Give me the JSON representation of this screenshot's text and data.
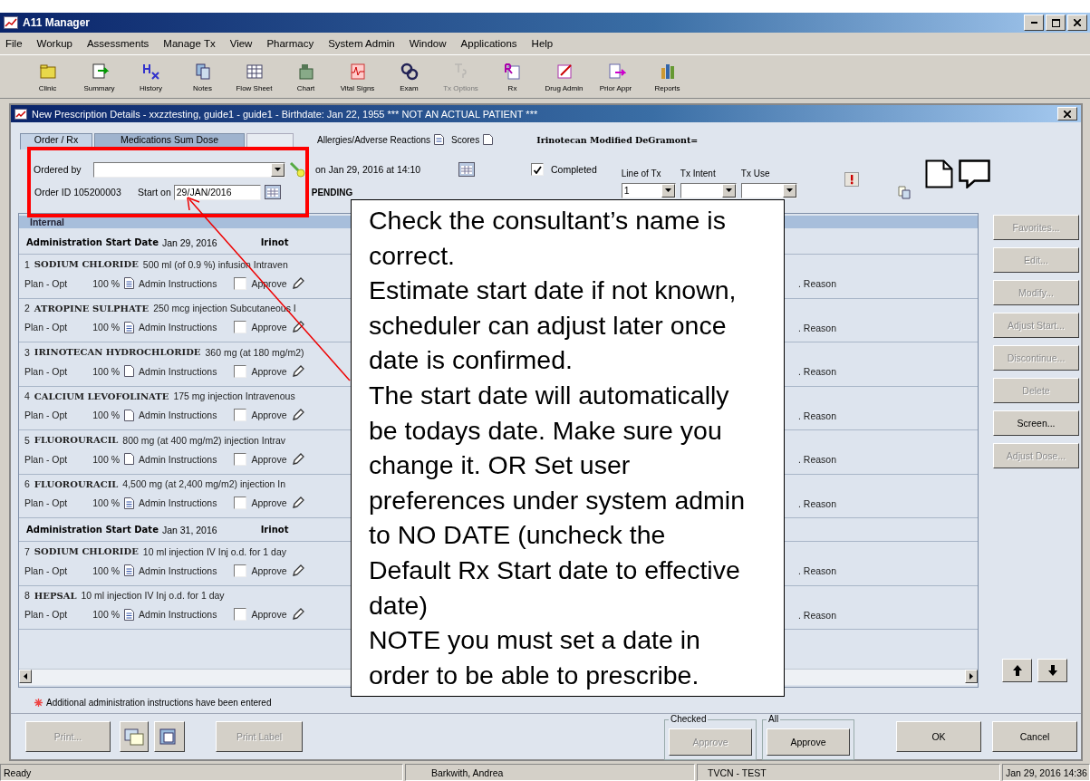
{
  "window": {
    "title": "A11 Manager"
  },
  "menu": [
    "File",
    "Workup",
    "Assessments",
    "Manage Tx",
    "View",
    "Pharmacy",
    "System Admin",
    "Window",
    "Applications",
    "Help"
  ],
  "toolbar": [
    {
      "label": "Clinic",
      "disabled": false
    },
    {
      "label": "Summary",
      "disabled": false
    },
    {
      "label": "History",
      "disabled": false
    },
    {
      "label": "Notes",
      "disabled": false
    },
    {
      "label": "Flow Sheet",
      "disabled": false
    },
    {
      "label": "Chart",
      "disabled": false
    },
    {
      "label": "Vital Signs",
      "disabled": false
    },
    {
      "label": "Exam",
      "disabled": false
    },
    {
      "label": "Tx Options",
      "disabled": true
    },
    {
      "label": "Rx",
      "disabled": false
    },
    {
      "label": "Drug Admin",
      "disabled": false
    },
    {
      "label": "Prior Appr",
      "disabled": false
    },
    {
      "label": "Reports",
      "disabled": false
    }
  ],
  "dialog": {
    "title": "New Prescription Details - xxzztesting, guide1  - guide1 - Birthdate: Jan 22, 1955 *** NOT AN ACTUAL PATIENT ***",
    "tabs": [
      {
        "label": "Order / Rx",
        "selected": true
      },
      {
        "label": "Medications Sum Dose",
        "selected": false
      }
    ],
    "allergies": "Allergies/Adverse Reactions",
    "scores": "Scores",
    "regimen": "Irinotecan Modified DeGramont=",
    "ordered_by_label": "Ordered by",
    "ordered_on": "on Jan 29, 2016  at 14:10",
    "completed": {
      "label": "Completed",
      "checked": true
    },
    "line_of_tx": {
      "label": "Line of Tx",
      "value": "1"
    },
    "tx_intent": {
      "label": "Tx Intent"
    },
    "tx_use": {
      "label": "Tx Use"
    },
    "order_id": "Order ID 105200003",
    "start_on": {
      "label": "Start on",
      "value": "29/JAN/2016"
    },
    "status": "PENDING",
    "section": "Internal",
    "groups": [
      {
        "label": "Administration Start Date",
        "date": "Jan 29, 2016",
        "regimen": "Irinot",
        "items": [
          {
            "number": "1",
            "drug": "SODIUM CHLORIDE",
            "detail": "500 ml (of 0.9 %) infusion Intraven",
            "plan": "Plan - Opt",
            "percent": "100 %",
            "has_instructions": true,
            "instructions": "Admin Instructions",
            "approved": false,
            "approve": "Approve",
            "reason": ". Reason"
          },
          {
            "number": "2",
            "drug": "ATROPINE SULPHATE",
            "detail": "250 mcg injection Subcutaneous I",
            "plan": "Plan - Opt",
            "percent": "100 %",
            "has_instructions": true,
            "instructions": "Admin Instructions",
            "approved": false,
            "approve": "Approve",
            "reason": ". Reason"
          },
          {
            "number": "3",
            "drug": "IRINOTECAN HYDROCHLORIDE",
            "detail": "360 mg (at 180 mg/m2)",
            "plan": "Plan - Opt",
            "percent": "100 %",
            "has_instructions": false,
            "instructions": "Admin Instructions",
            "approved": false,
            "approve": "Approve",
            "reason": ". Reason"
          },
          {
            "number": "4",
            "drug": "CALCIUM LEVOFOLINATE",
            "detail": "175 mg injection Intravenous",
            "plan": "Plan - Opt",
            "percent": "100 %",
            "has_instructions": false,
            "instructions": "Admin Instructions",
            "approved": false,
            "approve": "Approve",
            "reason": ". Reason"
          },
          {
            "number": "5",
            "drug": "FLUOROURACIL",
            "detail": "800 mg (at 400 mg/m2) injection Intrav",
            "plan": "Plan - Opt",
            "percent": "100 %",
            "has_instructions": false,
            "instructions": "Admin Instructions",
            "approved": false,
            "approve": "Approve",
            "reason": ". Reason"
          },
          {
            "number": "6",
            "drug": "FLUOROURACIL",
            "detail": "4,500 mg (at 2,400 mg/m2) injection In",
            "plan": "Plan - Opt",
            "percent": "100 %",
            "has_instructions": true,
            "instructions": "Admin Instructions",
            "approved": false,
            "approve": "Approve",
            "reason": ". Reason"
          }
        ]
      },
      {
        "label": "Administration Start Date",
        "date": "Jan 31, 2016",
        "regimen": "Irinot",
        "items": [
          {
            "number": "7",
            "drug": "SODIUM CHLORIDE",
            "detail": "10 ml injection IV Inj o.d. for 1 day",
            "plan": "Plan - Opt",
            "percent": "100 %",
            "has_instructions": true,
            "instructions": "Admin Instructions",
            "approved": false,
            "approve": "Approve",
            "reason": ". Reason"
          },
          {
            "number": "8",
            "drug": "HEPSAL",
            "detail": "10 ml injection IV Inj o.d. for 1 day",
            "plan": "Plan - Opt",
            "percent": "100 %",
            "has_instructions": true,
            "instructions": "Admin Instructions",
            "approved": false,
            "approve": "Approve",
            "reason": ". Reason"
          }
        ]
      }
    ],
    "side_buttons": [
      {
        "label": "Favorites...",
        "disabled": true
      },
      {
        "label": "Edit...",
        "disabled": true
      },
      {
        "label": "Modify...",
        "disabled": true
      },
      {
        "label": "Adjust Start...",
        "disabled": true
      },
      {
        "label": "Discontinue...",
        "disabled": true
      },
      {
        "label": "Delete",
        "disabled": true
      },
      {
        "label": "Screen...",
        "disabled": false
      },
      {
        "label": "Adjust Dose...",
        "disabled": true
      }
    ],
    "note": "Additional administration instructions have been entered",
    "print": {
      "label": "Print...",
      "disabled": true
    },
    "print_label": {
      "label": "Print Label",
      "disabled": true
    },
    "checked_group": {
      "label": "Checked",
      "button": "Approve",
      "disabled": true
    },
    "all_group": {
      "label": "All",
      "button": "Approve",
      "disabled": false
    },
    "ok": "OK",
    "cancel": "Cancel"
  },
  "status_bar": [
    "Ready",
    "Barkwith, Andrea",
    "TVCN - TEST",
    "Jan 29, 2016 14:36"
  ],
  "callout": {
    "paragraphs": [
      "Check the consultant’s name is correct.",
      "Estimate start date if not known, scheduler can adjust later once date is confirmed.",
      "The start date will automatically be todays date. Make sure you change it. OR Set user preferences under system admin to NO DATE (uncheck the Default Rx Start date to effective date)",
      "NOTE you must set a date in order to be able to prescribe."
    ]
  }
}
